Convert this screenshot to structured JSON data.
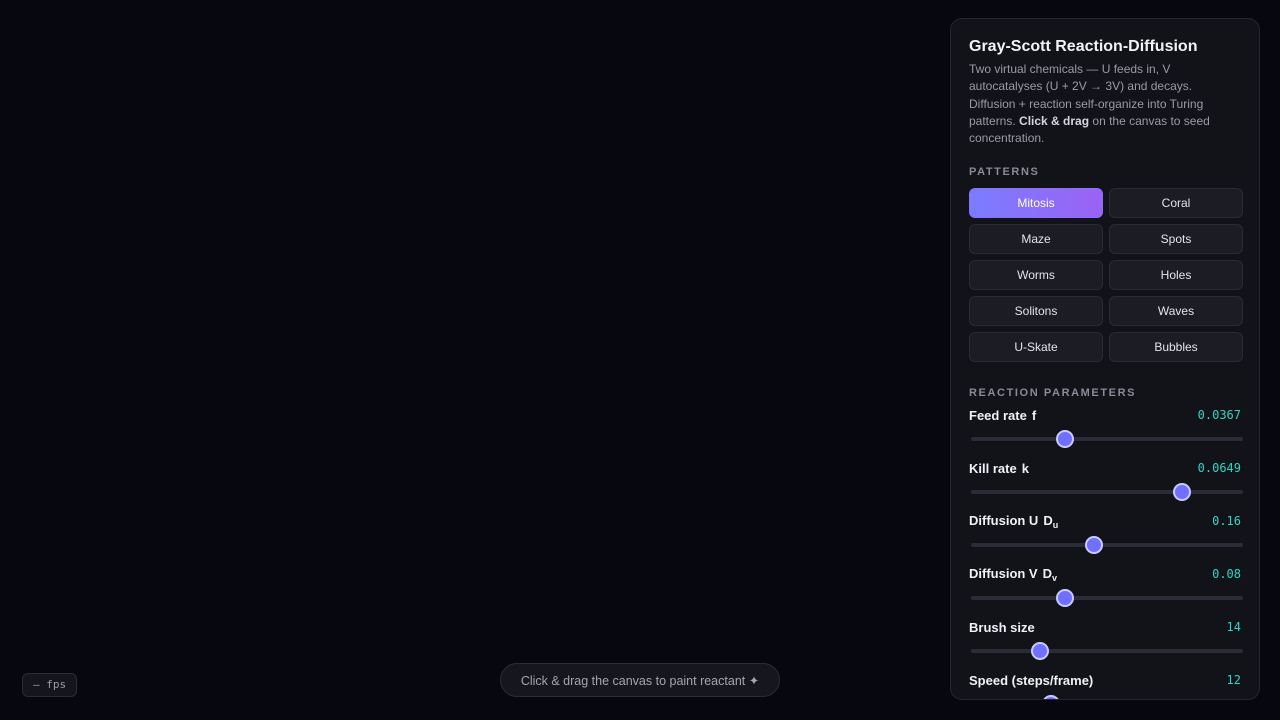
{
  "canvas": {
    "background": "#07070f"
  },
  "panel": {
    "title": "Gray-Scott Reaction-Diffusion",
    "description_before": "Two virtual chemicals — U feeds in, V autocatalyses (U + 2V → 3V) and decays. Diffusion + reaction self-organize into Turing patterns. ",
    "description_bold": "Click & drag",
    "description_after": " on the canvas to seed concentration.",
    "patterns_label": "PATTERNS",
    "patterns": [
      {
        "label": "Mitosis",
        "active": true
      },
      {
        "label": "Coral",
        "active": false
      },
      {
        "label": "Maze",
        "active": false
      },
      {
        "label": "Spots",
        "active": false
      },
      {
        "label": "Worms",
        "active": false
      },
      {
        "label": "Holes",
        "active": false
      },
      {
        "label": "Solitons",
        "active": false
      },
      {
        "label": "Waves",
        "active": false
      },
      {
        "label": "U-Skate",
        "active": false
      },
      {
        "label": "Bubbles",
        "active": false
      }
    ],
    "params_label": "REACTION PARAMETERS",
    "params": [
      {
        "name": "Feed rate",
        "symbol": "f",
        "sub": "",
        "value": "0.0367",
        "level": 0.34
      },
      {
        "name": "Kill rate",
        "symbol": "k",
        "sub": "",
        "value": "0.0649",
        "level": 0.765
      },
      {
        "name": "Diffusion U",
        "symbol": "D",
        "sub": "u",
        "value": "0.16",
        "level": 0.446
      },
      {
        "name": "Diffusion V",
        "symbol": "D",
        "sub": "v",
        "value": "0.08",
        "level": 0.34
      },
      {
        "name": "Brush size",
        "symbol": "",
        "sub": "",
        "value": "14",
        "level": 0.248
      },
      {
        "name": "Speed (steps/frame)",
        "symbol": "",
        "sub": "",
        "value": "12",
        "level": 0.29
      }
    ]
  },
  "fps": {
    "text": "— fps"
  },
  "hint": {
    "text": "Click & drag the canvas to paint reactant ✦"
  },
  "colors": {
    "accent": "#7b7cff",
    "accent_end": "#9a63f5",
    "value": "#31d6c4",
    "panel": "#121219"
  }
}
